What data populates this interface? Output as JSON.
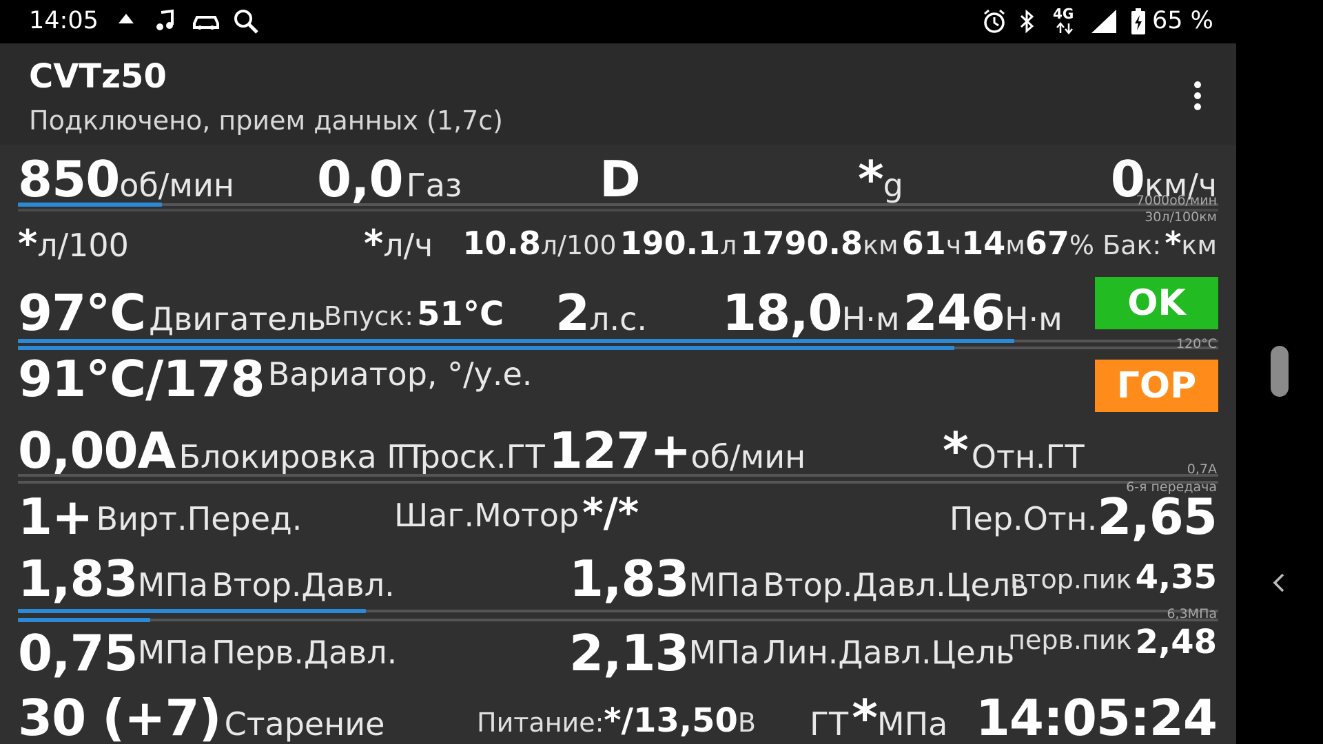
{
  "status_bar": {
    "time": "14:05",
    "network": "4G",
    "battery_percent": "65 %"
  },
  "app_bar": {
    "title": "CVTz50",
    "subtitle": "Подключено, прием данных (1,7с)"
  },
  "rows": {
    "r1": {
      "rpm_value": "850",
      "rpm_unit": "об/мин",
      "throttle_value": "0,0",
      "throttle_label": "Газ",
      "gear": "D",
      "g_value": "*",
      "g_unit": "g",
      "speed_value": "0",
      "speed_unit": "км/ч",
      "rpm_scale": "7000об/мин",
      "cons_scale": "30л/100км",
      "rpm_fraction": 0.12
    },
    "r2": {
      "cons_value": "*",
      "cons_unit": "л/100",
      "hourly_value": "*",
      "hourly_unit": "л/ч",
      "avg_value": "10.8",
      "avg_unit": "л/100",
      "fuel_value": "190.1",
      "fuel_unit": "л",
      "dist_value": "1790.8",
      "dist_unit": "км",
      "time_h": "61",
      "time_h_unit": "ч",
      "time_m": "14",
      "time_m_unit": "м",
      "tank_value": "67",
      "tank_unit": "% Бак:",
      "range_value": "*",
      "range_unit": "км"
    },
    "r3": {
      "engine_temp": "97°C",
      "engine_label": "Двигатель",
      "intake_label": "Впуск:",
      "intake_value": "51°C",
      "power_value": "2",
      "power_unit": "л.с.",
      "torque_value": "18,0",
      "torque_unit": "Н·м",
      "torque_max": "246",
      "torque_max_unit": "Н·м",
      "status_ok": "OK",
      "temp_scale": "120°C",
      "engine_temp_fraction": 0.83,
      "cvt_temp_fraction": 0.78
    },
    "r4": {
      "cvt_value": "91°C/178",
      "cvt_label": "Вариатор, °/у.е.",
      "status_hot": "ГОР"
    },
    "r5": {
      "lockup_value": "0,00A",
      "lockup_label": "Блокировка ГТ",
      "slip_label": "Проск.ГТ",
      "slip_value": "127+",
      "slip_unit": "об/мин",
      "ratio_tc_value": "*",
      "ratio_tc_label": "Отн.ГТ",
      "lockup_scale": "0,7A",
      "gear_scale": "6-я передача"
    },
    "r6": {
      "vgear_value": "1+",
      "vgear_label": "Вирт.Перед.",
      "stepper_label": "Шаг.Мотор",
      "stepper_value": "*/*",
      "ratio_label": "Пер.Отн.",
      "ratio_value": "2,65"
    },
    "r7": {
      "sec_value": "1,83",
      "sec_unit": "МПа",
      "sec_label": "Втор.Давл.",
      "sec_target_value": "1,83",
      "sec_target_unit": "МПа",
      "sec_target_label": "Втор.Давл.Цель",
      "sec_peak_label": "втор.пик",
      "sec_peak_value": "4,35",
      "pressure_scale": "6,3МПа",
      "sec_fraction": 0.29,
      "pri_fraction": 0.11
    },
    "r8": {
      "pri_value": "0,75",
      "pri_unit": "МПа",
      "pri_label": "Перв.Давл.",
      "line_target_value": "2,13",
      "line_target_unit": "МПа",
      "line_target_label": "Лин.Давл.Цель",
      "pri_peak_label": "перв.пик",
      "pri_peak_value": "2,48"
    },
    "r9": {
      "aging_value": "30 (+7)",
      "aging_label": "Старение",
      "power_label": "Питание:",
      "power_value": "*/13,50",
      "power_unit": "В",
      "tc_label": "ГТ",
      "tc_value": "*",
      "tc_unit": "МПа",
      "clock": "14:05:24"
    }
  },
  "colors": {
    "ok_badge": "#22bb22",
    "hot_badge": "#ff8c1a",
    "bar_fill": "#2a8ad8",
    "background": "#303030"
  }
}
